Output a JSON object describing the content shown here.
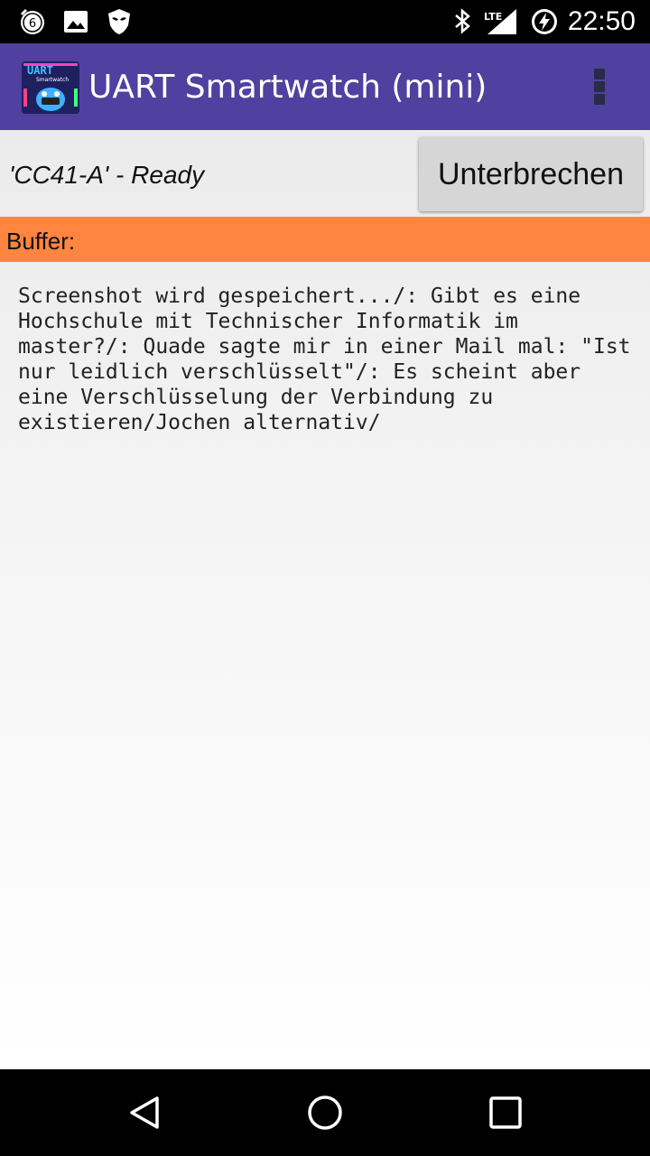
{
  "status_bar": {
    "time": "22:50",
    "notification_icons": [
      "alarm-6-icon",
      "image-icon",
      "shield-mask-icon"
    ],
    "system_icons": [
      "bluetooth-icon",
      "lte-signal-icon",
      "battery-charging-icon"
    ],
    "network_label": "LTE",
    "alarm_badge": "6"
  },
  "app_bar": {
    "title": "UART Smartwatch (mini)",
    "logo_icon": "uart-smartwatch-logo-icon",
    "logo_text": "UART",
    "logo_subtext": "Smartwatch",
    "menu_icon": "overflow-menu-icon",
    "background_color": "#5040a0"
  },
  "connection": {
    "status": "'CC41-A' - Ready",
    "button_label": "Unterbrechen"
  },
  "buffer": {
    "label": "Buffer:",
    "header_color": "#ff8540",
    "content": "Screenshot wird gespeichert.../: Gibt es eine Hochschule mit Technischer Informatik im master?/: Quade sagte mir in einer Mail mal: \"Ist nur leidlich verschlüsselt\"/: Es scheint aber eine Verschlüsselung der Verbindung zu existieren/Jochen alternativ/"
  },
  "nav_bar": {
    "back_icon": "back-triangle-icon",
    "home_icon": "home-circle-icon",
    "recents_icon": "recents-square-icon"
  }
}
